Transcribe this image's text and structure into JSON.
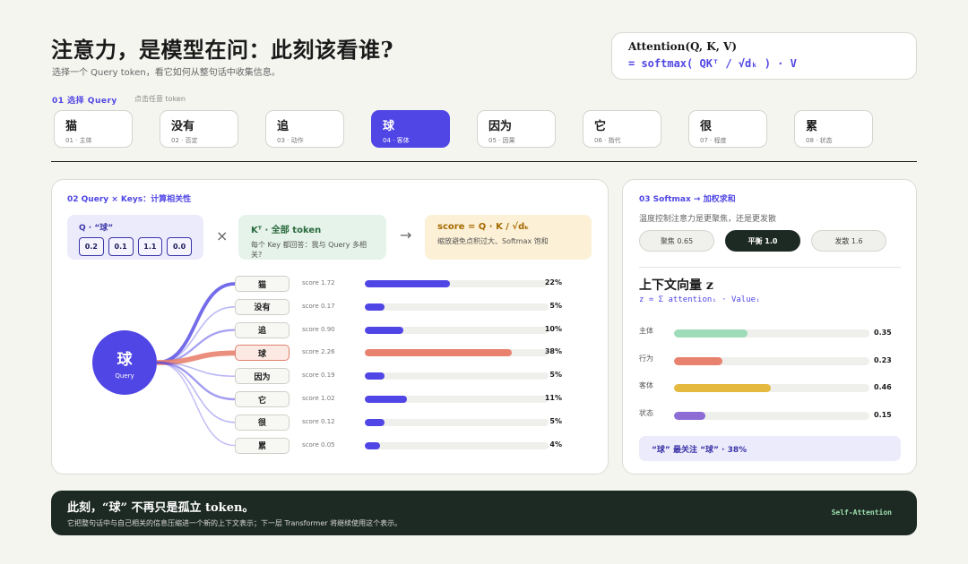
{
  "header": {
    "title": "注意力，是模型在问：此刻该看谁?",
    "subtitle": "选择一个 Query token，看它如何从整句话中收集信息。"
  },
  "formula": {
    "line1": "Attention(Q, K, V)",
    "line2": "= softmax( QKᵀ / √dₖ ) · V"
  },
  "step1": {
    "title": "01 选择 Query",
    "hint": "点击任意 token"
  },
  "tokens": [
    {
      "word": "猫",
      "meta": "01 · 主体",
      "active": false
    },
    {
      "word": "没有",
      "meta": "02 · 否定",
      "active": false
    },
    {
      "word": "追",
      "meta": "03 · 动作",
      "active": false
    },
    {
      "word": "球",
      "meta": "04 · 客体",
      "active": true
    },
    {
      "word": "因为",
      "meta": "05 · 因果",
      "active": false
    },
    {
      "word": "它",
      "meta": "06 · 指代",
      "active": false
    },
    {
      "word": "很",
      "meta": "07 · 程度",
      "active": false
    },
    {
      "word": "累",
      "meta": "08 · 状态",
      "active": false
    }
  ],
  "panel2": {
    "title": "02 Query × Keys：计算相关性",
    "query_label": "Q · “球”",
    "query_vector": [
      "0.2",
      "0.1",
      "1.1",
      "0.0"
    ],
    "times": "×",
    "keys_label": "Kᵀ · 全部 token",
    "keys_desc": "每个 Key 都回答：我与 Query 多相关?",
    "arrow": "→",
    "score_label": "score = Q · K / √dₖ",
    "score_desc": "缩放避免点积过大、Softmax 饱和",
    "query_node_word": "球",
    "query_node_label": "Query"
  },
  "chart_data": {
    "type": "bar",
    "categories": [
      "猫",
      "没有",
      "追",
      "球",
      "因为",
      "它",
      "很",
      "累"
    ],
    "score_labels": [
      "score 1.72",
      "score 0.17",
      "score 0.90",
      "score 2.26",
      "score 0.19",
      "score 1.02",
      "score 0.12",
      "score 0.05"
    ],
    "scores": [
      1.72,
      0.17,
      0.9,
      2.26,
      0.19,
      1.02,
      0.12,
      0.05
    ],
    "weights": [
      22,
      5,
      10,
      38,
      5,
      11,
      5,
      4
    ],
    "weight_labels": [
      "22%",
      "5%",
      "10%",
      "38%",
      "5%",
      "11%",
      "5%",
      "4%"
    ],
    "highlight_index": 3,
    "ylim": [
      0,
      100
    ],
    "colors": {
      "normal": "#5046e5",
      "highlight": "#e8826f"
    }
  },
  "panel3": {
    "title": "03 Softmax → 加权求和",
    "subtitle": "温度控制注意力是更聚焦，还是更发散",
    "temps": [
      {
        "label": "聚焦 0.65",
        "active": false
      },
      {
        "label": "平衡 1.0",
        "active": true
      },
      {
        "label": "发散 1.6",
        "active": false
      }
    ],
    "z_title": "上下文向量 z",
    "z_formula": "z = Σ attentionᵢ · Valueᵢ",
    "components": [
      {
        "label": "主体",
        "value": 0.35,
        "display": "0.35",
        "color": "#9edbb8"
      },
      {
        "label": "行为",
        "value": 0.23,
        "display": "0.23",
        "color": "#e8826f"
      },
      {
        "label": "客体",
        "value": 0.46,
        "display": "0.46",
        "color": "#e5b93e"
      },
      {
        "label": "状态",
        "value": 0.15,
        "display": "0.15",
        "color": "#8d6cd6"
      }
    ],
    "focus": "“球” 最关注 “球” · 38%"
  },
  "footer": {
    "title": "此刻，“球” 不再只是孤立 token。",
    "subtitle": "它把整句话中与自己相关的信息压缩进一个新的上下文表示；下一层 Transformer 将继续使用这个表示。",
    "tag": "Self-Attention"
  }
}
